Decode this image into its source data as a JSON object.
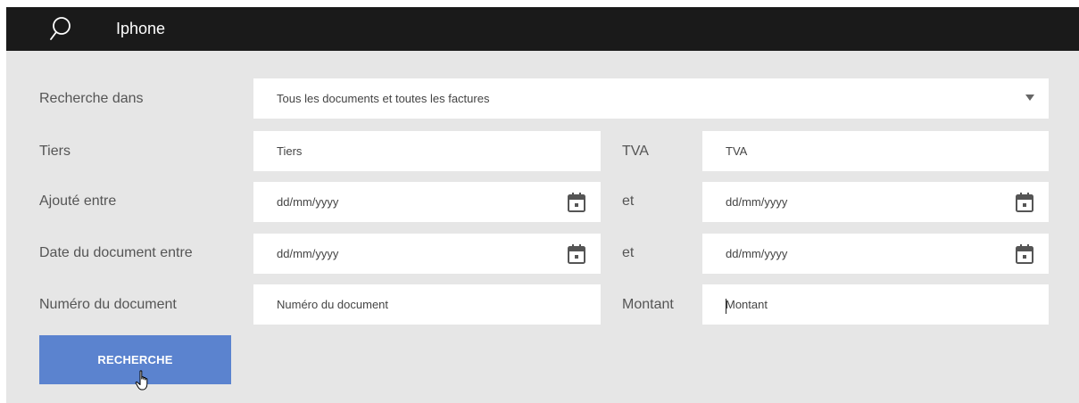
{
  "search": {
    "query": "Iphone"
  },
  "form": {
    "search_in": {
      "label": "Recherche dans",
      "value": "Tous les documents et toutes les factures"
    },
    "tiers": {
      "label": "Tiers",
      "placeholder": "Tiers"
    },
    "tva": {
      "label": "TVA",
      "placeholder": "TVA"
    },
    "added_between": {
      "label": "Ajouté entre",
      "from": "dd/mm/yyyy",
      "and_label": "et",
      "to": "dd/mm/yyyy"
    },
    "doc_date_between": {
      "label": "Date du document entre",
      "from": "dd/mm/yyyy",
      "and_label": "et",
      "to": "dd/mm/yyyy"
    },
    "doc_number": {
      "label": "Numéro du document",
      "placeholder": "Numéro du document"
    },
    "amount": {
      "label": "Montant",
      "placeholder": "Montant"
    },
    "submit_label": "RECHERCHE"
  },
  "colors": {
    "topbar": "#1a1a1a",
    "panel": "#e6e6e6",
    "button": "#5b83cf"
  },
  "icons": [
    "search-icon",
    "calendar-icon",
    "dropdown-caret-icon",
    "hand-pointer-cursor"
  ]
}
